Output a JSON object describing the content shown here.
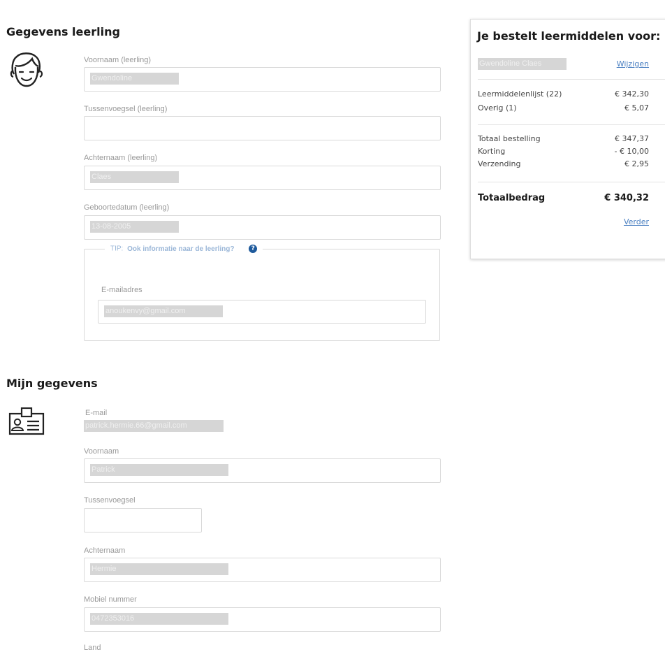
{
  "student": {
    "title": "Gegevens leerling",
    "first_name_label": "Voornaam (leerling)",
    "first_name_value": "Gwendoline",
    "infix_label": "Tussenvoegsel (leerling)",
    "infix_value": "",
    "last_name_label": "Achternaam (leerling)",
    "last_name_value": "Claes",
    "birthdate_label": "Geboortedatum (leerling)",
    "birthdate_value": "13-08-2005",
    "tip_prefix": "TIP:",
    "tip_text": "Ook informatie naar de leerling?",
    "email_label": "E-mailadres",
    "email_value": "anoukenvy@gmail.com"
  },
  "mine": {
    "title": "Mijn gegevens",
    "email_label": "E-mail",
    "email_value": "patrick.hermie.66@gmail.com",
    "first_name_label": "Voornaam",
    "first_name_value": "Patrick",
    "infix_label": "Tussenvoegsel",
    "infix_value": "",
    "last_name_label": "Achternaam",
    "last_name_value": "Hermie",
    "mobile_label": "Mobiel nummer",
    "mobile_value": "0472353016",
    "country_label": "Land"
  },
  "summary": {
    "title": "Je bestelt leermiddelen voor:",
    "student_name": "Gwendoline Claes",
    "change_link": "Wijzigen",
    "list_label": "Leermiddelenlijst (22)",
    "list_value": "€ 342,30",
    "other_label": "Overig (1)",
    "other_value": "€ 5,07",
    "order_total_label": "Totaal bestelling",
    "order_total_value": "€ 347,37",
    "discount_label": "Korting",
    "discount_value": "- € 10,00",
    "shipping_label": "Verzending",
    "shipping_value": "€ 2,95",
    "grand_total_label": "Totaalbedrag",
    "grand_total_value": "€ 340,32",
    "next_link": "Verder"
  },
  "icons": {
    "student": "face-icon",
    "mine": "id-card-icon",
    "tip": "help-icon"
  },
  "colors": {
    "link": "#4a7fc1",
    "tip": "#9bb7d8",
    "help_icon": "#1e5a9c",
    "redaction": "#d6d6d6"
  }
}
